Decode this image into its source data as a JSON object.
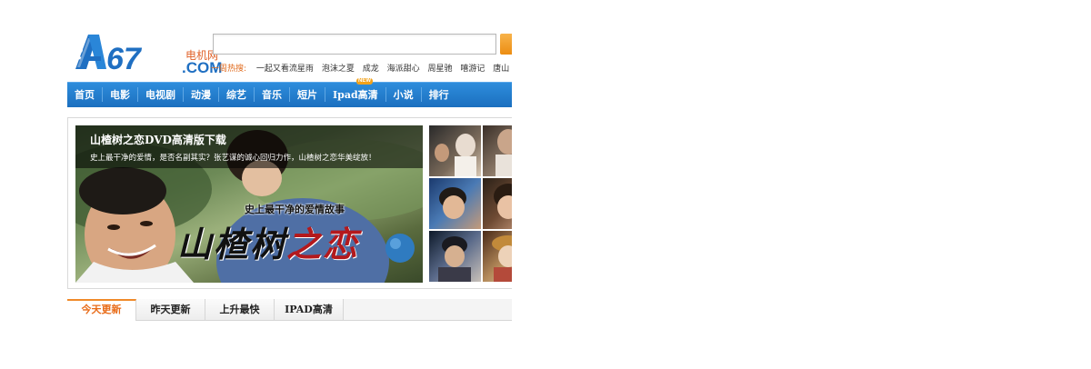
{
  "header": {
    "logo_text": "A67",
    "logo_cn": "电机网",
    "logo_com": ".COM",
    "search": {
      "value": "",
      "placeholder": ""
    }
  },
  "hot_words": {
    "label": "一周热搜:",
    "items": [
      "一起又看流星雨",
      "泡沫之夏",
      "成龙",
      "海派甜心",
      "周星驰",
      "嘻游记",
      "唐山"
    ]
  },
  "nav": {
    "items": [
      {
        "label": "首页"
      },
      {
        "label": "电影"
      },
      {
        "label": "电视剧"
      },
      {
        "label": "动漫"
      },
      {
        "label": "综艺"
      },
      {
        "label": "音乐"
      },
      {
        "label": "短片"
      },
      {
        "label": "Ipad高清",
        "badge": "NEW"
      },
      {
        "label": "小说"
      },
      {
        "label": "排行"
      }
    ]
  },
  "banner": {
    "title": "山楂树之恋DVD高清版下载",
    "description": "史上最干净的爱情，是否名副其实？张艺谋的诚心回归力作，山楂树之恋华美绽放！",
    "tagline": "史上最干净的爱情故事",
    "callig_black": "山楂树",
    "callig_red": "之恋"
  },
  "tabs": [
    {
      "label": "今天更新",
      "active": true
    },
    {
      "label": "昨天更新"
    },
    {
      "label": "上升最快"
    },
    {
      "label": "IPAD高清"
    }
  ],
  "colors": {
    "nav_blue": "#1f7fd2",
    "accent_orange": "#e86a16",
    "logo_blue": "#1f6fc2"
  }
}
